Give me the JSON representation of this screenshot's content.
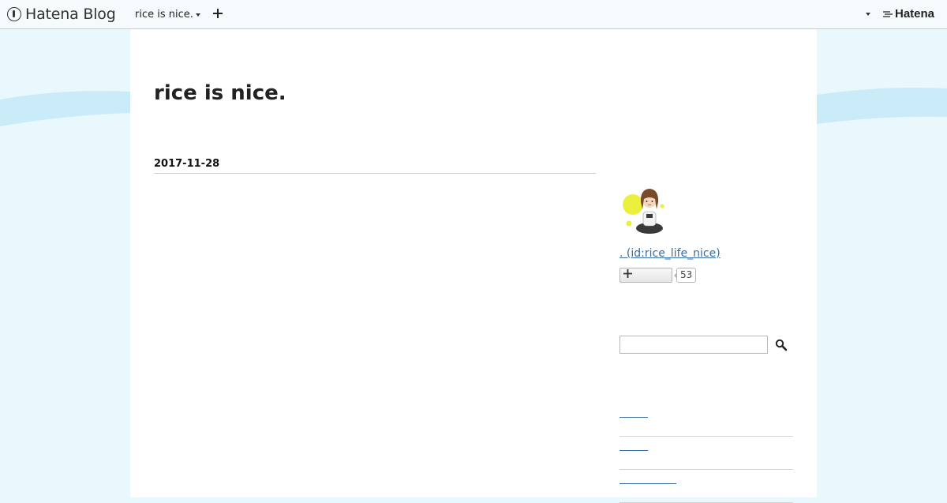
{
  "navbar": {
    "brand": "Hatena Blog",
    "blog_switch_label": "rice is nice.",
    "add_icon": "plus-icon",
    "account_menu_icon": "caret-down-icon",
    "hatena_logo": "Hatena"
  },
  "blog": {
    "title": "rice is nice."
  },
  "entry": {
    "date": "2017-11-28"
  },
  "sidebar": {
    "profile": {
      "link_text": ". (id:rice_life_nice)",
      "avatar_icon": "avatar-icon"
    },
    "follow": {
      "button_icon": "plus-icon",
      "count": "53"
    },
    "search": {
      "placeholder": "",
      "button_icon": "magnifier-icon"
    },
    "categories": [
      "",
      "",
      ""
    ]
  },
  "colors": {
    "background": "#e9f8fc",
    "wave": "#c9ecf8",
    "link": "#3a6fa0",
    "navbar": "#f5fafc"
  }
}
